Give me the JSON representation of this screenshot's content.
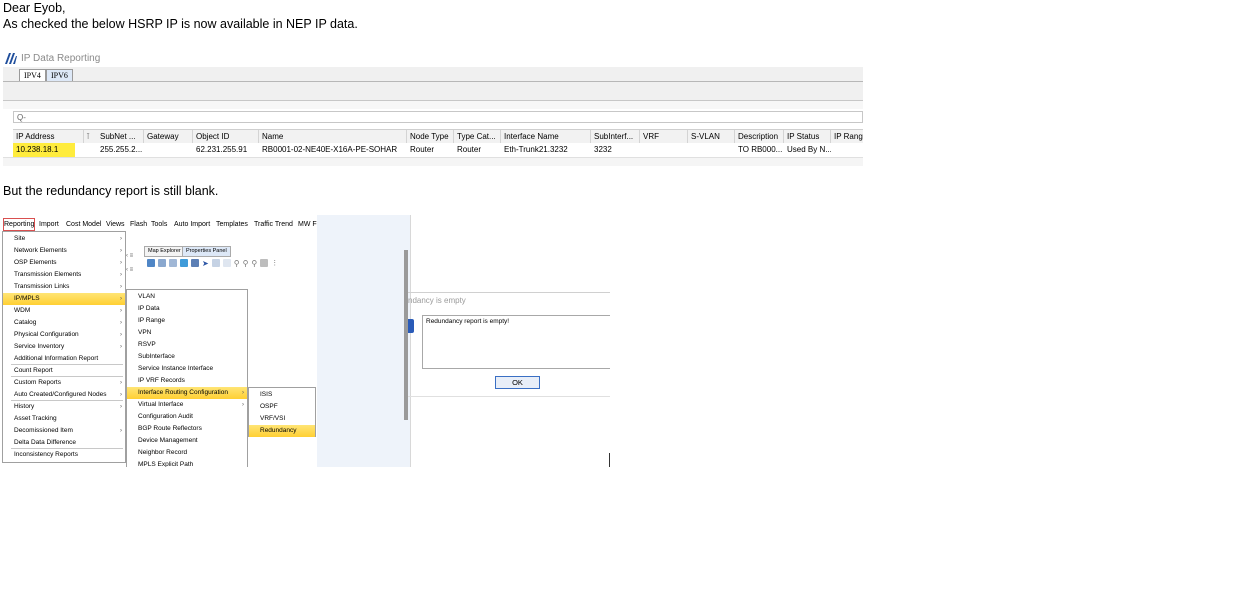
{
  "email": {
    "greeting": "Dear Eyob,",
    "line1": "As checked the below HSRP IP is now available in NEP IP data.",
    "line2": "But the redundancy report is still blank."
  },
  "ip_window": {
    "title": "IP Data Reporting",
    "tabs": [
      "IPV4",
      "IPV6"
    ],
    "active_tab": "IPV6",
    "filter_placeholder": "Q-",
    "columns": [
      "IP Address",
      "SubNet ...",
      "Gateway",
      "Object ID",
      "Name",
      "Node Type",
      "Type Cat...",
      "Interface Name",
      "SubInterf...",
      "VRF",
      "S-VLAN",
      "Description",
      "IP Status",
      "IP Rang"
    ],
    "row": [
      "10.238.18.1",
      "255.255.2...",
      "",
      "62.231.255.91",
      "RB0001-02-NE40E-X16A-PE-SOHAR",
      "Router",
      "Router",
      "Eth-Trunk21.3232",
      "3232",
      "",
      "",
      "TO RB000...",
      "Used By N...",
      ""
    ],
    "colors": {
      "highlight": "#ffec3d",
      "logo": "#1f4e9c"
    }
  },
  "app": {
    "menubar": [
      "Reporting",
      "Import",
      "Cost Model",
      "Views",
      "Flash",
      "Tools",
      "Auto Import",
      "Templates",
      "Traffic Trend",
      "MW F"
    ],
    "active_menu": "Reporting",
    "reporting_menu": [
      {
        "label": "Site",
        "sub": true
      },
      {
        "label": "Network Elements",
        "sub": true
      },
      {
        "label": "OSP Elements",
        "sub": true
      },
      {
        "label": "Transmission Elements",
        "sub": true
      },
      {
        "label": "Transmission Links",
        "sub": true
      },
      {
        "label": "IP/MPLS",
        "sub": true,
        "hl": true
      },
      {
        "label": "WDM",
        "sub": true
      },
      {
        "label": "Catalog",
        "sub": true
      },
      {
        "label": "Physical Configuration",
        "sub": true
      },
      {
        "label": "Service Inventory",
        "sub": true
      },
      {
        "label": "Additional Information Report",
        "sub": false
      },
      {
        "label": "Count Report",
        "sub": false
      },
      {
        "label": "Custom Reports",
        "sub": true
      },
      {
        "label": "Auto Created/Configured Nodes",
        "sub": true
      },
      {
        "label": "History",
        "sub": true
      },
      {
        "label": "Asset Tracking",
        "sub": false
      },
      {
        "label": "Decomissioned Item",
        "sub": true
      },
      {
        "label": "Delta Data Difference",
        "sub": false
      },
      {
        "label": "Inconsistency Reports",
        "sub": false
      }
    ],
    "ipmpls_menu": [
      {
        "label": "VLAN",
        "sub": false
      },
      {
        "label": "IP Data",
        "sub": false
      },
      {
        "label": "IP Range",
        "sub": false
      },
      {
        "label": "VPN",
        "sub": false
      },
      {
        "label": "RSVP",
        "sub": false
      },
      {
        "label": "SubInterface",
        "sub": false
      },
      {
        "label": "Service Instance Interface",
        "sub": false
      },
      {
        "label": "IP VRF Records",
        "sub": false
      },
      {
        "label": "Interface Routing Configuration",
        "sub": true,
        "hl": true
      },
      {
        "label": "Virtual Interface",
        "sub": true
      },
      {
        "label": "Configuration Audit",
        "sub": false
      },
      {
        "label": "BGP Route Reflectors",
        "sub": false
      },
      {
        "label": "Device Management",
        "sub": false
      },
      {
        "label": "Neighbor Record",
        "sub": false
      },
      {
        "label": "MPLS Explicit Path",
        "sub": false
      }
    ],
    "irc_menu": [
      {
        "label": "ISIS",
        "sub": false
      },
      {
        "label": "OSPF",
        "sub": false
      },
      {
        "label": "VRF/VSI",
        "sub": false
      },
      {
        "label": "Redundancy",
        "sub": false,
        "hl": true
      }
    ],
    "map_tabs": [
      "Map Explorer",
      "Properties Panel"
    ],
    "dialog": {
      "title": "ndancy is empty",
      "message": "Redundancy report is empty!",
      "ok": "OK"
    }
  }
}
